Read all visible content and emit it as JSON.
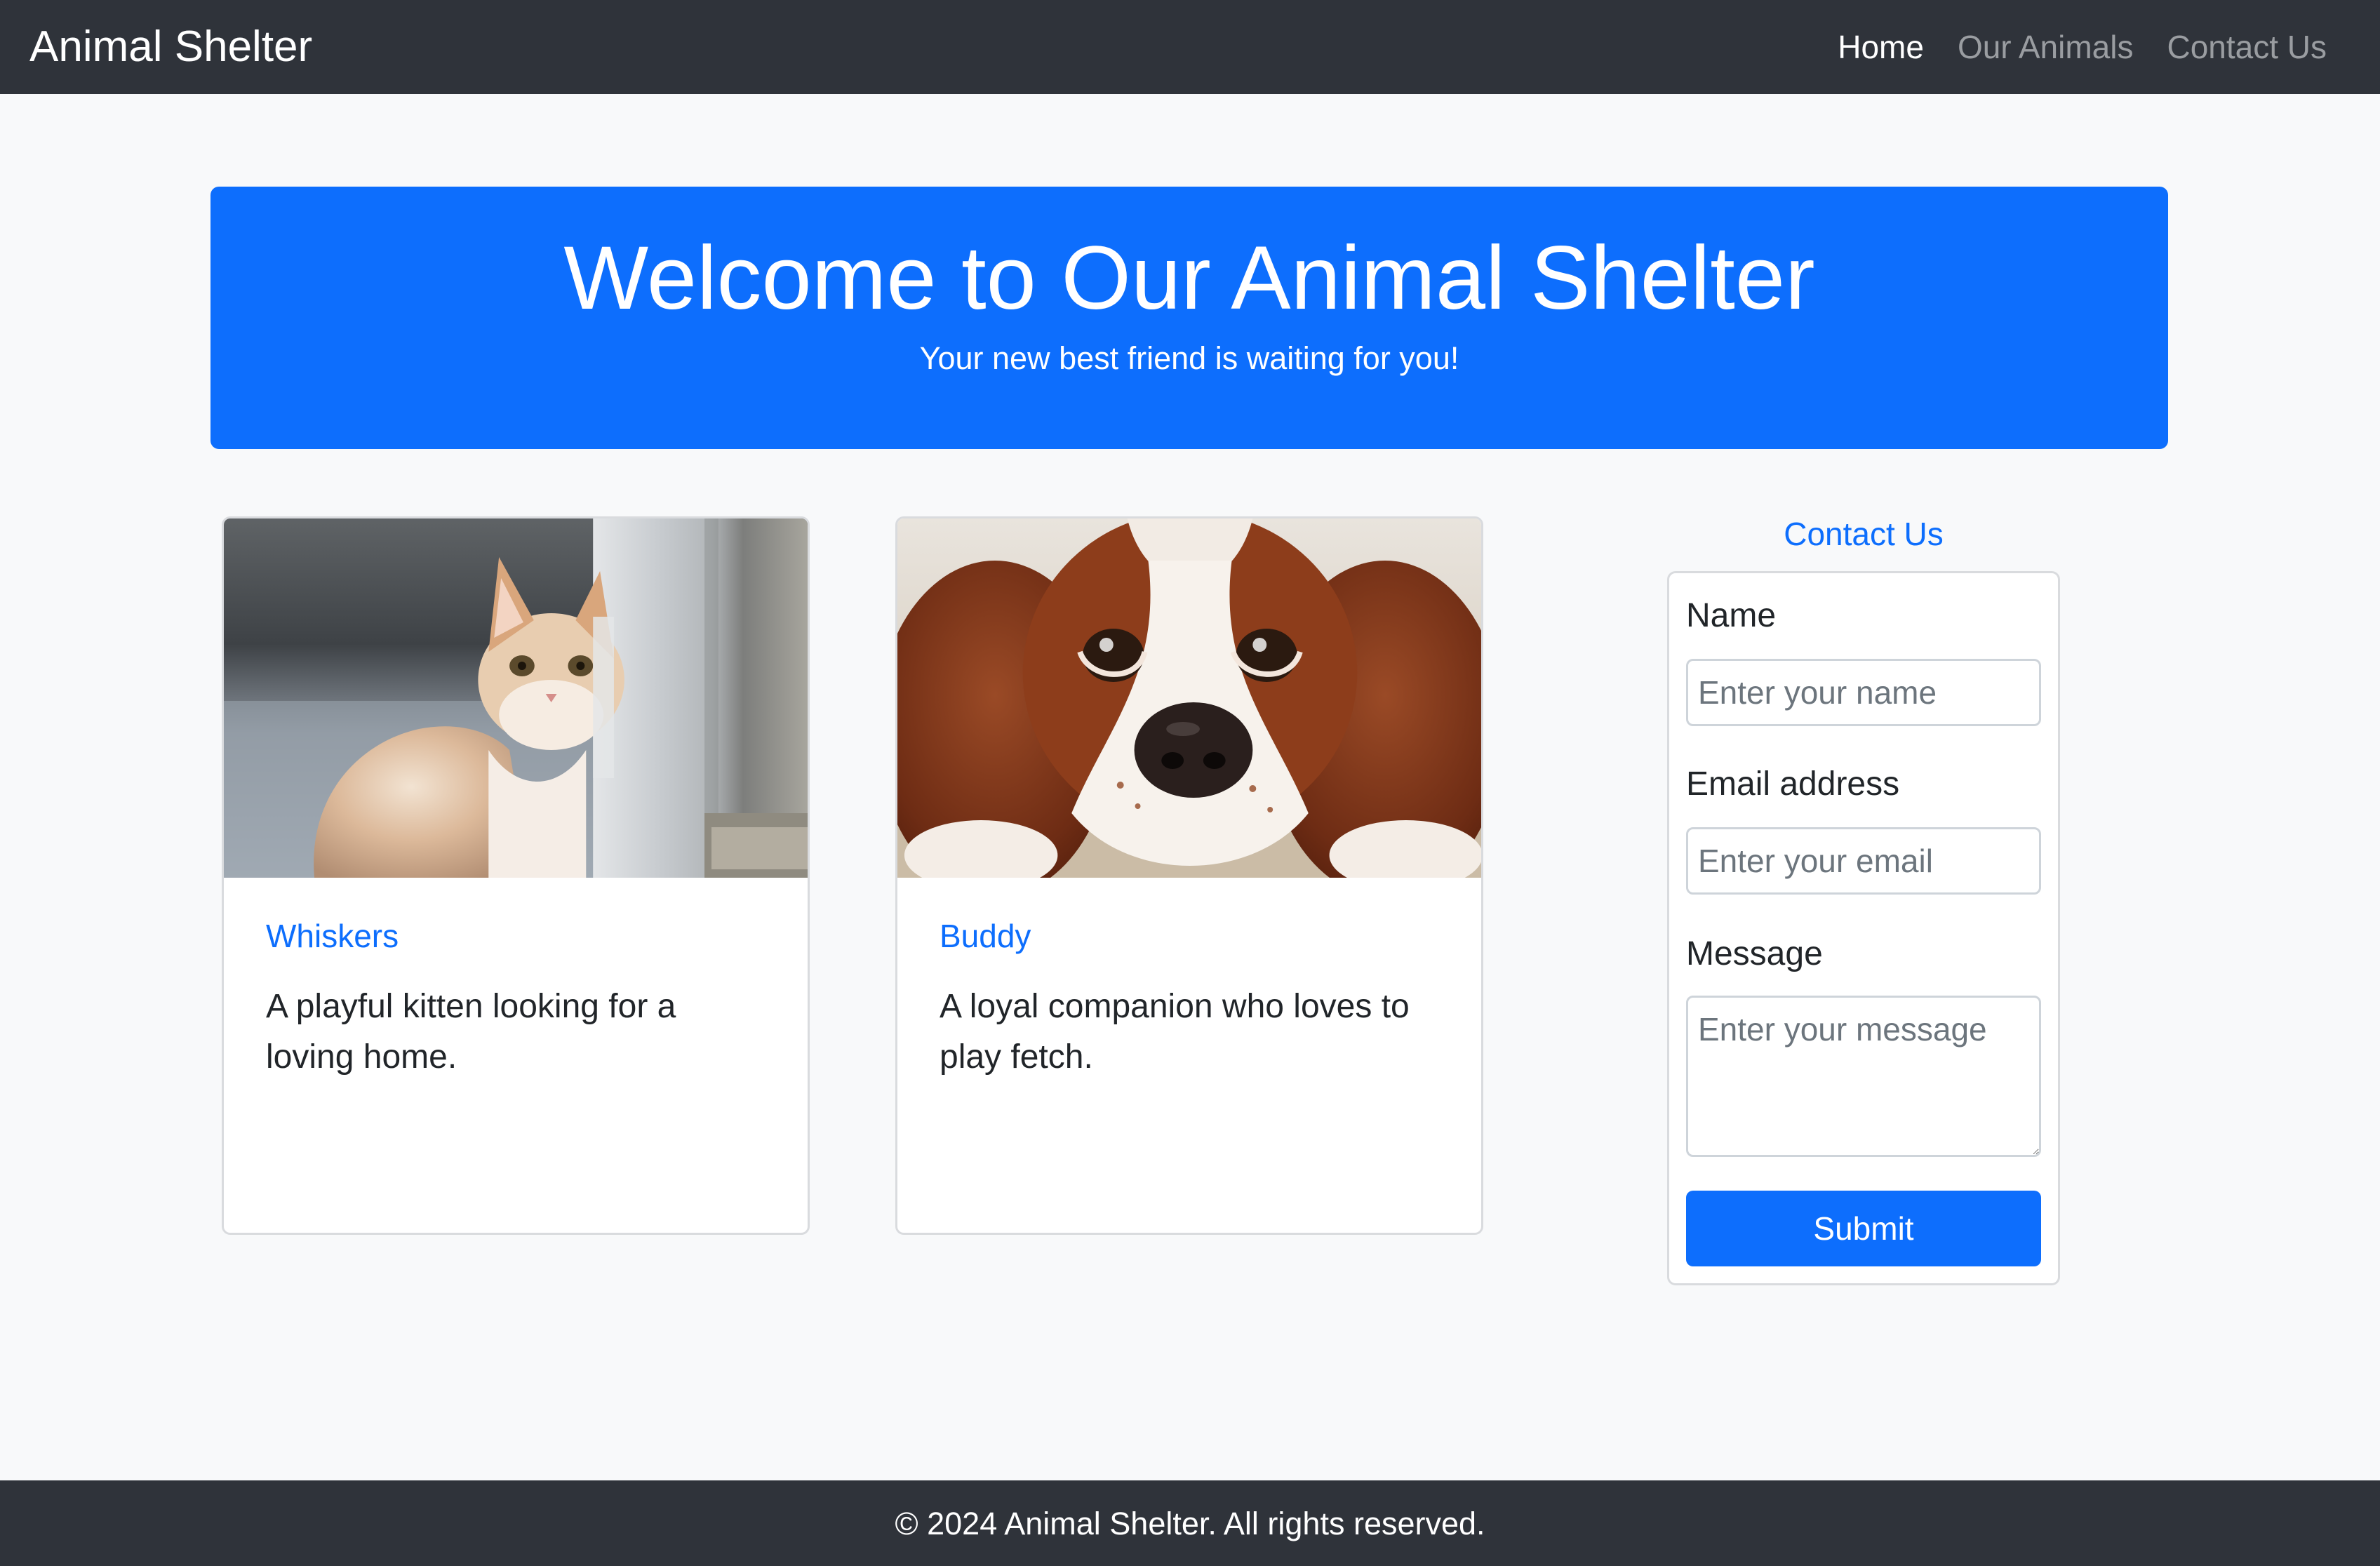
{
  "navbar": {
    "brand": "Animal Shelter",
    "links": [
      {
        "label": "Home",
        "active": true
      },
      {
        "label": "Our Animals",
        "active": false
      },
      {
        "label": "Contact Us",
        "active": false
      }
    ]
  },
  "hero": {
    "title": "Welcome to Our Animal Shelter",
    "subtitle": "Your new best friend is waiting for you!"
  },
  "animals": [
    {
      "name": "Whiskers",
      "description": "A playful kitten looking for a loving home.",
      "image_icon": "kitten-photo"
    },
    {
      "name": "Buddy",
      "description": "A loyal companion who loves to play fetch.",
      "image_icon": "puppy-photo"
    }
  ],
  "contact": {
    "heading": "Contact Us",
    "name_label": "Name",
    "name_placeholder": "Enter your name",
    "email_label": "Email address",
    "email_placeholder": "Enter your email",
    "message_label": "Message",
    "message_placeholder": "Enter your message",
    "submit_label": "Submit"
  },
  "footer": {
    "text": "© 2024 Animal Shelter. All rights reserved."
  },
  "colors": {
    "navbar_bg": "#2f333a",
    "primary": "#0d6efd",
    "page_bg": "#f8f9fa",
    "muted_link": "#9a9da1"
  }
}
